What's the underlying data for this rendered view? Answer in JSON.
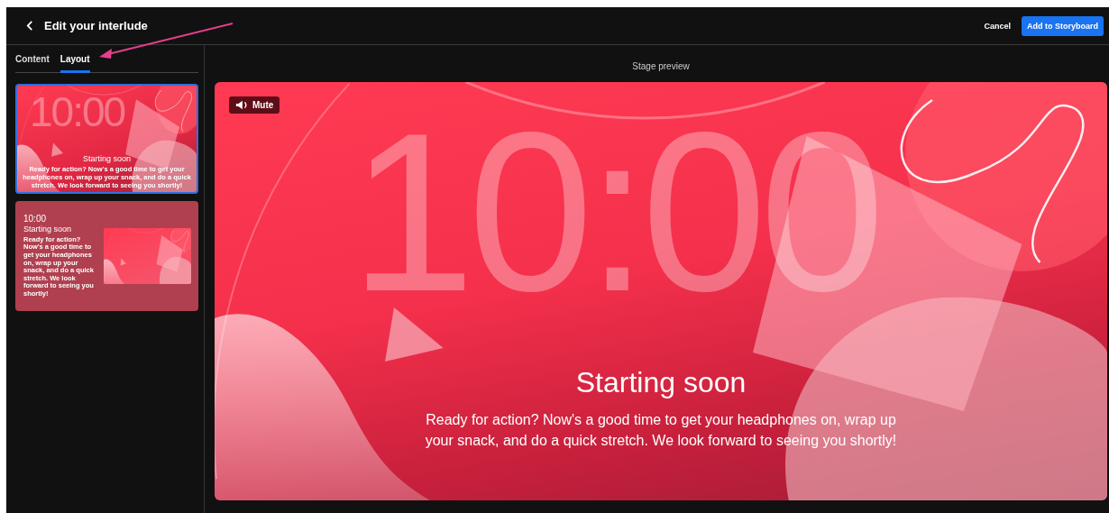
{
  "header": {
    "title": "Edit your interlude",
    "cancel": "Cancel",
    "primary": "Add to Storyboard"
  },
  "tabs": [
    {
      "label": "Content",
      "selected": false
    },
    {
      "label": "Layout",
      "selected": true
    }
  ],
  "layouts": [
    {
      "kind": "fullscreen",
      "selected": true,
      "timer": "10:00",
      "title": "Starting soon",
      "body": "Ready for action? Now's a good time to get your headphones on, wrap up your snack, and do a quick stretch. We look forward to seeing you shortly!"
    },
    {
      "kind": "split",
      "selected": false,
      "timer": "10:00",
      "title": "Starting soon",
      "body": "Ready for action? Now's a good time to get your headphones on, wrap up your snack, and do a quick stretch. We look forward to seeing you shortly!"
    }
  ],
  "stage": {
    "label": "Stage preview",
    "mute": "Mute",
    "timer": "10:00",
    "title": "Starting soon",
    "body": "Ready for action? Now's a good time to get your headphones on, wrap up your snack, and do a quick stretch. We look forward to seeing you shortly!"
  }
}
